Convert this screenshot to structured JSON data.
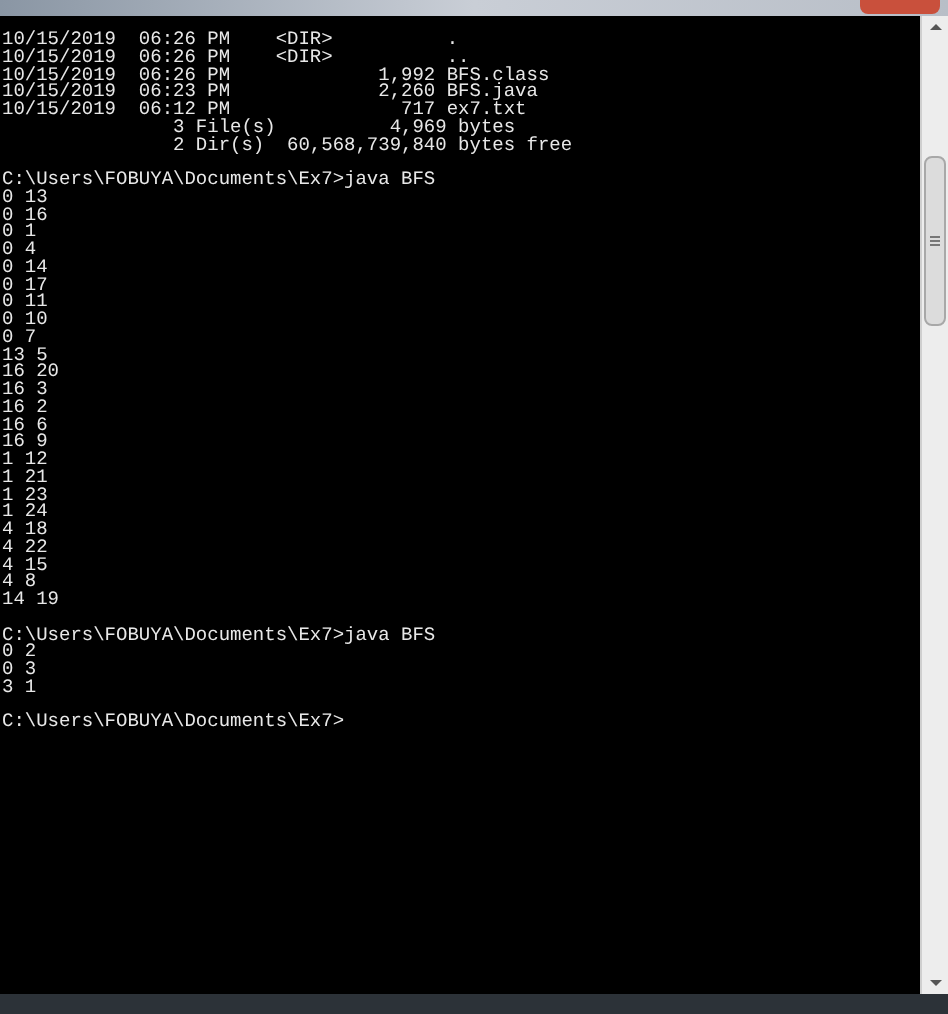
{
  "console": {
    "lines": [
      {
        "kind": "text",
        "text": "10/15/2019  06:26 PM    <DIR>          ."
      },
      {
        "kind": "text",
        "text": "10/15/2019  06:26 PM    <DIR>          .."
      },
      {
        "kind": "text",
        "text": "10/15/2019  06:26 PM             1,992 BFS.class"
      },
      {
        "kind": "text",
        "text": "10/15/2019  06:23 PM             2,260 BFS.java"
      },
      {
        "kind": "text",
        "text": "10/15/2019  06:12 PM               717 ex7.txt"
      },
      {
        "kind": "text",
        "text": "               3 File(s)          4,969 bytes"
      },
      {
        "kind": "text",
        "text": "               2 Dir(s)  60,568,739,840 bytes free"
      },
      {
        "kind": "blank"
      },
      {
        "kind": "text",
        "text": "C:\\Users\\FOBUYA\\Documents\\Ex7>java BFS"
      },
      {
        "kind": "text",
        "text": "0 13"
      },
      {
        "kind": "text",
        "text": "0 16"
      },
      {
        "kind": "text",
        "text": "0 1"
      },
      {
        "kind": "text",
        "text": "0 4"
      },
      {
        "kind": "text",
        "text": "0 14"
      },
      {
        "kind": "text",
        "text": "0 17"
      },
      {
        "kind": "text",
        "text": "0 11"
      },
      {
        "kind": "text",
        "text": "0 10"
      },
      {
        "kind": "text",
        "text": "0 7"
      },
      {
        "kind": "text",
        "text": "13 5"
      },
      {
        "kind": "text",
        "text": "16 20"
      },
      {
        "kind": "text",
        "text": "16 3"
      },
      {
        "kind": "text",
        "text": "16 2"
      },
      {
        "kind": "text",
        "text": "16 6"
      },
      {
        "kind": "text",
        "text": "16 9"
      },
      {
        "kind": "text",
        "text": "1 12"
      },
      {
        "kind": "text",
        "text": "1 21"
      },
      {
        "kind": "text",
        "text": "1 23"
      },
      {
        "kind": "text",
        "text": "1 24"
      },
      {
        "kind": "text",
        "text": "4 18"
      },
      {
        "kind": "text",
        "text": "4 22"
      },
      {
        "kind": "text",
        "text": "4 15"
      },
      {
        "kind": "text",
        "text": "4 8"
      },
      {
        "kind": "text",
        "text": "14 19"
      },
      {
        "kind": "blank"
      },
      {
        "kind": "text",
        "text": "C:\\Users\\FOBUYA\\Documents\\Ex7>java BFS"
      },
      {
        "kind": "text",
        "text": "0 2"
      },
      {
        "kind": "text",
        "text": "0 3"
      },
      {
        "kind": "text",
        "text": "3 1"
      },
      {
        "kind": "blank"
      },
      {
        "kind": "text",
        "text": "C:\\Users\\FOBUYA\\Documents\\Ex7>"
      }
    ]
  }
}
